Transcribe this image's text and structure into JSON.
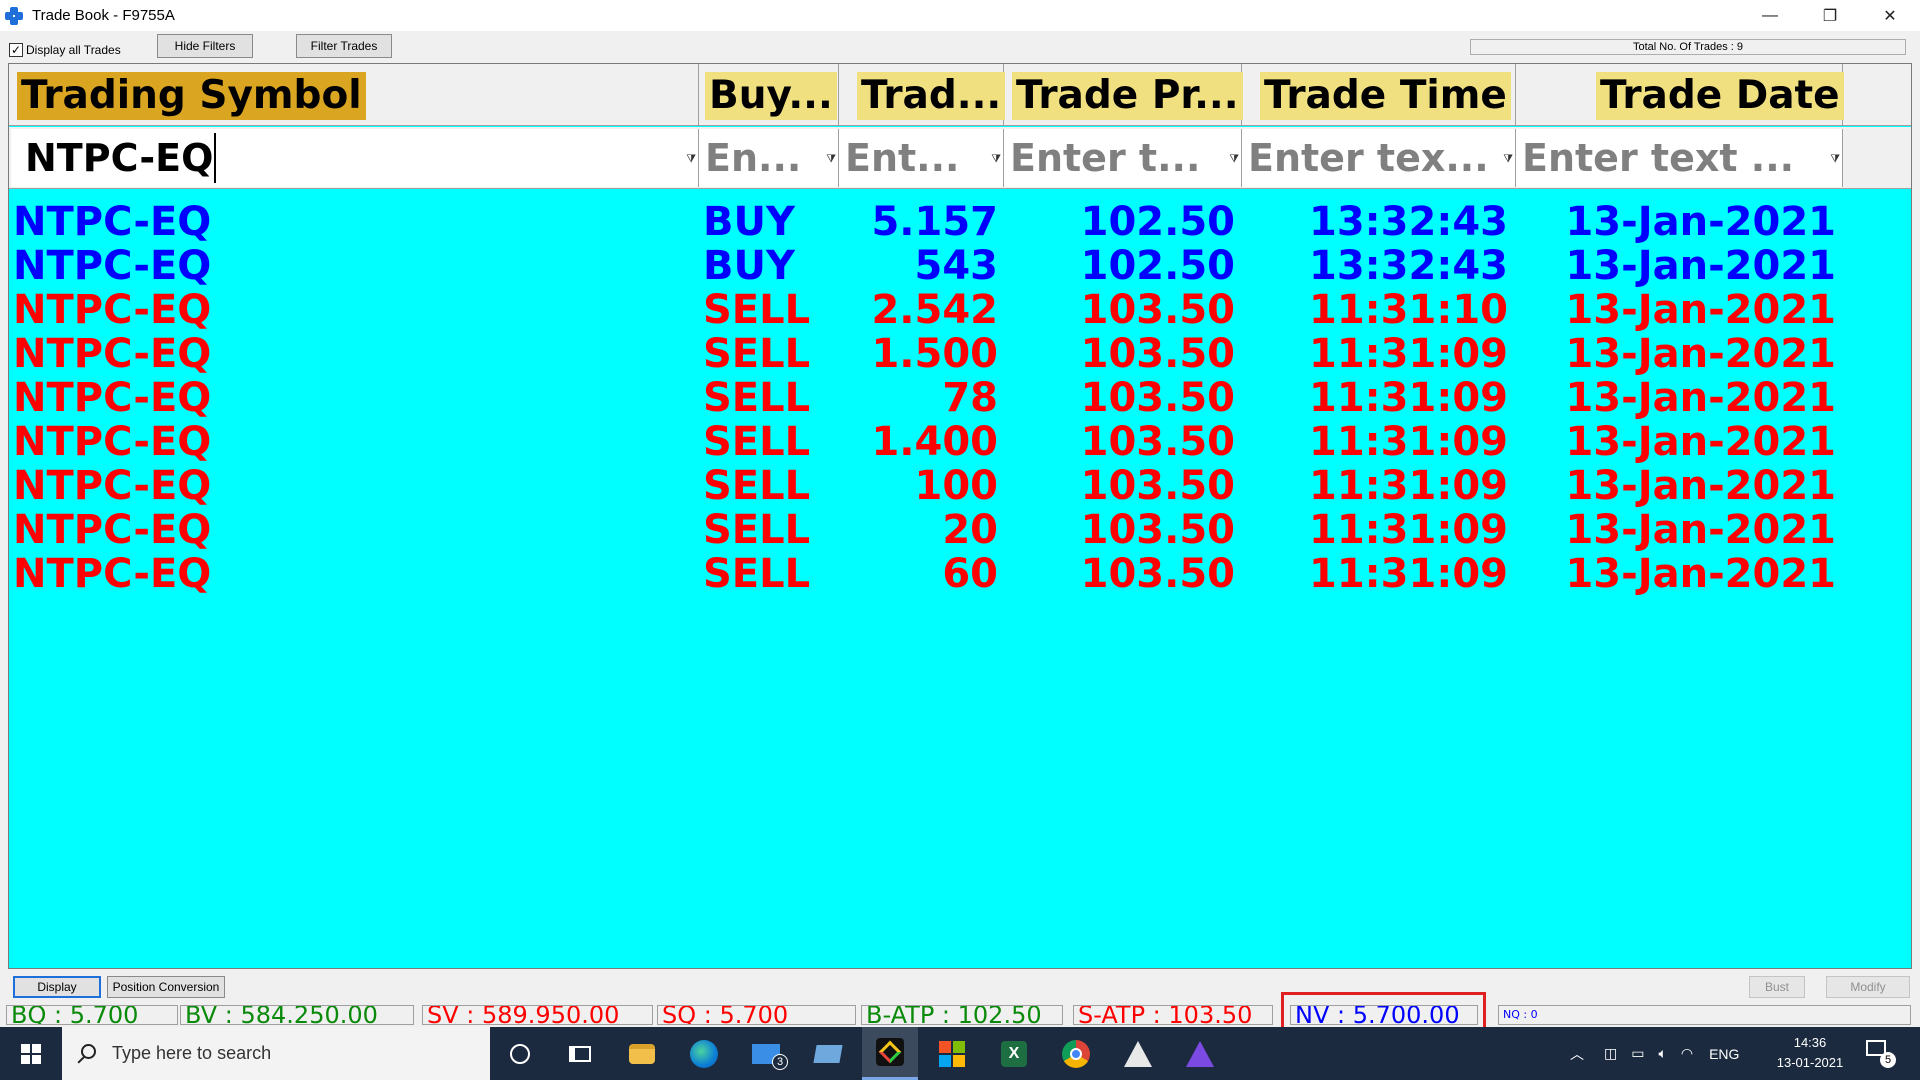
{
  "window": {
    "title": "Trade Book - F9755A",
    "minimize": "—",
    "restore": "❐",
    "close": "✕"
  },
  "toolbar": {
    "display_all_label": "Display all Trades",
    "display_all_checked": "✓",
    "hide_filters_label": "Hide Filters",
    "filter_trades_label": "Filter Trades",
    "total_trades_label": "Total No. Of Trades : 9"
  },
  "columns": [
    {
      "label": "Trading Symbol",
      "highlight": "#daa520"
    },
    {
      "label": "Buy...",
      "highlight": "#f0e080"
    },
    {
      "label": "Trad...",
      "highlight": "#f0e080"
    },
    {
      "label": "Trade Pr...",
      "highlight": "#f0e080"
    },
    {
      "label": "Trade Time",
      "highlight": "#f0e080"
    },
    {
      "label": "Trade Date",
      "highlight": "#f0e080"
    }
  ],
  "filters": [
    {
      "value": "NTPC-EQ",
      "placeholder": ""
    },
    {
      "value": "",
      "placeholder": "En..."
    },
    {
      "value": "",
      "placeholder": "Ent..."
    },
    {
      "value": "",
      "placeholder": "Enter t..."
    },
    {
      "value": "",
      "placeholder": "Enter tex..."
    },
    {
      "value": "",
      "placeholder": "Enter text ..."
    }
  ],
  "colors": {
    "buy": "#0000ff",
    "sell": "#ff0000",
    "grid_bg": "#00ffff"
  },
  "trades": [
    {
      "symbol": "NTPC-EQ",
      "side": "BUY",
      "qty": "5.157",
      "price": "102.50",
      "time": "13:32:43",
      "date": "13-Jan-2021"
    },
    {
      "symbol": "NTPC-EQ",
      "side": "BUY",
      "qty": "543",
      "price": "102.50",
      "time": "13:32:43",
      "date": "13-Jan-2021"
    },
    {
      "symbol": "NTPC-EQ",
      "side": "SELL",
      "qty": "2.542",
      "price": "103.50",
      "time": "11:31:10",
      "date": "13-Jan-2021"
    },
    {
      "symbol": "NTPC-EQ",
      "side": "SELL",
      "qty": "1.500",
      "price": "103.50",
      "time": "11:31:09",
      "date": "13-Jan-2021"
    },
    {
      "symbol": "NTPC-EQ",
      "side": "SELL",
      "qty": "78",
      "price": "103.50",
      "time": "11:31:09",
      "date": "13-Jan-2021"
    },
    {
      "symbol": "NTPC-EQ",
      "side": "SELL",
      "qty": "1.400",
      "price": "103.50",
      "time": "11:31:09",
      "date": "13-Jan-2021"
    },
    {
      "symbol": "NTPC-EQ",
      "side": "SELL",
      "qty": "100",
      "price": "103.50",
      "time": "11:31:09",
      "date": "13-Jan-2021"
    },
    {
      "symbol": "NTPC-EQ",
      "side": "SELL",
      "qty": "20",
      "price": "103.50",
      "time": "11:31:09",
      "date": "13-Jan-2021"
    },
    {
      "symbol": "NTPC-EQ",
      "side": "SELL",
      "qty": "60",
      "price": "103.50",
      "time": "11:31:09",
      "date": "13-Jan-2021"
    }
  ],
  "bottom": {
    "display_label": "Display",
    "position_conversion_label": "Position Conversion",
    "bust_label": "Bust",
    "modify_label": "Modify",
    "stats": {
      "bq": "BQ : 5.700",
      "bv": "BV : 584.250.00",
      "sv": "SV : 589.950.00",
      "sq": "SQ : 5.700",
      "batp": "B-ATP : 102.50",
      "satp": "S-ATP : 103.50",
      "nv": "NV : 5.700.00",
      "nq": "NQ : 0"
    }
  },
  "taskbar": {
    "search_placeholder": "Type here to search",
    "mail_badge": "3",
    "apps": [
      "cortana-icon",
      "task-view-icon",
      "file-explorer-icon",
      "edge-icon",
      "mail-icon",
      "laptop-icon",
      "trading-app-icon",
      "store-icon",
      "excel-icon",
      "chrome-icon",
      "triangle-app-icon",
      "prism-app-icon"
    ],
    "lang": "ENG",
    "time": "14:36",
    "date": "13-01-2021",
    "notification_count": "5"
  }
}
